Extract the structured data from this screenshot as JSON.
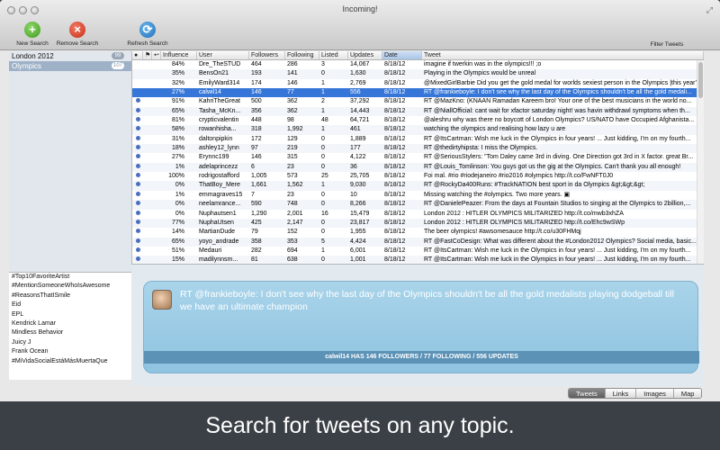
{
  "window": {
    "title": "Incoming!"
  },
  "toolbar": {
    "new_search": "New Search",
    "remove_search": "Remove Search",
    "refresh_search": "Refresh Search",
    "filter_tweets": "Filter Tweets"
  },
  "searches": [
    {
      "label": "London 2012",
      "count": "99",
      "selected": false
    },
    {
      "label": "Olympics",
      "count": "107",
      "selected": true
    }
  ],
  "trends": [
    "#Top10FavoriteArtist",
    "#MentionSomeoneWhoIsAwesome",
    "#ReasonsThatISmile",
    "Eid",
    "EPL",
    "Kendrick Lamar",
    "Mindless Behavior",
    "Juicy J",
    "Frank Ocean",
    "#MiVidaSocialEstáMásMuertaQue"
  ],
  "table": {
    "headers": [
      "●",
      "⚑",
      "↩",
      "Influence",
      "User",
      "Followers",
      "Following",
      "Listed",
      "Updates",
      "Date",
      "Tweet"
    ],
    "sorted_column": "Date",
    "rows": [
      {
        "dot": false,
        "influence": "84%",
        "user": "Dre_TheSTUD",
        "followers": "464",
        "following": "286",
        "listed": "3",
        "updates": "14,067",
        "date": "8/18/12",
        "tweet": "imagine if twerkin was in the olympics!!! ;o"
      },
      {
        "dot": false,
        "influence": "35%",
        "user": "BensOn21",
        "followers": "193",
        "following": "141",
        "listed": "0",
        "updates": "1,630",
        "date": "8/18/12",
        "tweet": "Playing in the Olympics would be unreal"
      },
      {
        "dot": false,
        "influence": "32%",
        "user": "EmilyWard314",
        "followers": "174",
        "following": "146",
        "listed": "1",
        "updates": "2,769",
        "date": "8/18/12",
        "tweet": "@MixedGirlBarbie Did you get the gold medal for worlds sexiest person in the Olympics |this year?"
      },
      {
        "dot": false,
        "influence": "27%",
        "user": "calwil14",
        "followers": "146",
        "following": "77",
        "listed": "1",
        "updates": "556",
        "date": "8/18/12",
        "tweet": "RT @frankieboyle: I don't see why the last day of the Olympics shouldn't be all the gold medali...",
        "selected": true
      },
      {
        "dot": true,
        "influence": "91%",
        "user": "KahriTheGreat",
        "followers": "500",
        "following": "362",
        "listed": "2",
        "updates": "37,292",
        "date": "8/18/12",
        "tweet": "RT @MazKno: (KNAAN Ramadan Kareem bro! Your one of the best musicians in the world no..."
      },
      {
        "dot": true,
        "influence": "65%",
        "user": "Tasha_McKn...",
        "followers": "356",
        "following": "362",
        "listed": "1",
        "updates": "14,443",
        "date": "8/18/12",
        "tweet": "RT @NiallOfficial: cant wait for xfactor saturday night! was havin withdrawl symptoms when th..."
      },
      {
        "dot": true,
        "influence": "81%",
        "user": "crypticvalentin",
        "followers": "448",
        "following": "98",
        "listed": "48",
        "updates": "64,721",
        "date": "8/18/12",
        "tweet": "@aleshru why was there no boycott of London Olympics? US/NATO have Occupied Afghanista..."
      },
      {
        "dot": true,
        "influence": "58%",
        "user": "rowanhisha...",
        "followers": "318",
        "following": "1,992",
        "listed": "1",
        "updates": "461",
        "date": "8/18/12",
        "tweet": "watching the olympics and realising how lazy u are"
      },
      {
        "dot": true,
        "influence": "31%",
        "user": "daltonpipkin",
        "followers": "172",
        "following": "129",
        "listed": "0",
        "updates": "1,889",
        "date": "8/18/12",
        "tweet": "RT @ItsCartman: Wish me luck in the Olympics in four years! ... Just kidding, I'm on my fourth..."
      },
      {
        "dot": true,
        "influence": "18%",
        "user": "ashley12_lynn",
        "followers": "97",
        "following": "219",
        "listed": "0",
        "updates": "177",
        "date": "8/18/12",
        "tweet": "RT @thedirtyhipsta: I miss the Olympics."
      },
      {
        "dot": true,
        "influence": "27%",
        "user": "Erynnc199",
        "followers": "146",
        "following": "315",
        "listed": "0",
        "updates": "4,122",
        "date": "8/18/12",
        "tweet": "RT @SeriousStylers: \"Tom Daley came 3rd in diving. One Direction got 3rd in X factor. great Br..."
      },
      {
        "dot": true,
        "influence": "1%",
        "user": "adelaprincezz",
        "followers": "6",
        "following": "23",
        "listed": "0",
        "updates": "36",
        "date": "8/18/12",
        "tweet": "RT @Louis_Tomlinson: You guys got us the gig at the Olympics. Can't thank you all enough!"
      },
      {
        "dot": true,
        "influence": "100%",
        "user": "rodrigostafford",
        "followers": "1,005",
        "following": "573",
        "listed": "25",
        "updates": "25,705",
        "date": "8/18/12",
        "tweet": "Foi mal. #rio #riodejaneiro #rio2016 #olympics http://t.co/FwNFT0J0"
      },
      {
        "dot": true,
        "influence": "0%",
        "user": "ThatBoy_Mere",
        "followers": "1,661",
        "following": "1,562",
        "listed": "1",
        "updates": "9,030",
        "date": "8/18/12",
        "tweet": "RT @RockyDa400Runs: #TrackNATION best sport in da Olympics &gt;&gt;&gt;"
      },
      {
        "dot": true,
        "influence": "1%",
        "user": "emmagraves15",
        "followers": "7",
        "following": "23",
        "listed": "0",
        "updates": "10",
        "date": "8/18/12",
        "tweet": "Missing watching the #olympics. Two more years. ▣"
      },
      {
        "dot": true,
        "influence": "0%",
        "user": "neelamrance...",
        "followers": "590",
        "following": "748",
        "listed": "0",
        "updates": "8,266",
        "date": "8/18/12",
        "tweet": "RT @DanielePeazer: From the days at Fountain Studios to singing at the Olympics to 2billion,..."
      },
      {
        "dot": true,
        "influence": "0%",
        "user": "Nuphautsen1",
        "followers": "1,290",
        "following": "2,001",
        "listed": "16",
        "updates": "15,479",
        "date": "8/18/12",
        "tweet": "London 2012 : HITLER  OLYMPICS  MILITARIZED   http://t.co/mwb3xhZA"
      },
      {
        "dot": true,
        "influence": "77%",
        "user": "NuphaUtsen",
        "followers": "425",
        "following": "2,147",
        "listed": "0",
        "updates": "23,817",
        "date": "8/18/12",
        "tweet": "London 2012 : HITLER  OLYMPICS  MILITARIZED   http://t.co/Ehc9wSWp"
      },
      {
        "dot": true,
        "influence": "14%",
        "user": "MartianDude",
        "followers": "79",
        "following": "152",
        "listed": "0",
        "updates": "1,955",
        "date": "8/18/12",
        "tweet": "The beer olympics! #awsomesauce  http://t.co/u30FHMqj"
      },
      {
        "dot": true,
        "influence": "65%",
        "user": "yoyo_andrade",
        "followers": "358",
        "following": "353",
        "listed": "5",
        "updates": "4,424",
        "date": "8/18/12",
        "tweet": "RT @FastCoDesign: What was different about the #London2012 Olympics? Social media, basic..."
      },
      {
        "dot": true,
        "influence": "51%",
        "user": "Medauri",
        "followers": "282",
        "following": "694",
        "listed": "1",
        "updates": "6,001",
        "date": "8/18/12",
        "tweet": "RT @ItsCartman: Wish me luck in the Olympics in four years! ... Just kidding, I'm on my fourth..."
      },
      {
        "dot": true,
        "influence": "15%",
        "user": "madilynnsm...",
        "followers": "81",
        "following": "638",
        "listed": "0",
        "updates": "1,001",
        "date": "8/18/12",
        "tweet": "RT @ItsCartman: Wish me luck in the Olympics in four years! ... Just kidding, I'm on my fourth..."
      }
    ]
  },
  "detail": {
    "prefix": "RT ",
    "mention": "@frankieboyle",
    "text": ": I don't see why the last day of the Olympics shouldn't be all the gold medalists playing dodgeball till we have an ultimate champion",
    "footer": "calwil14 HAS 146 FOLLOWERS / 77 FOLLOWING / 556 UPDATES"
  },
  "tabs": [
    {
      "label": "Tweets",
      "active": true
    },
    {
      "label": "Links",
      "active": false
    },
    {
      "label": "Images",
      "active": false
    },
    {
      "label": "Map",
      "active": false
    }
  ],
  "caption": "Search for tweets on any topic."
}
